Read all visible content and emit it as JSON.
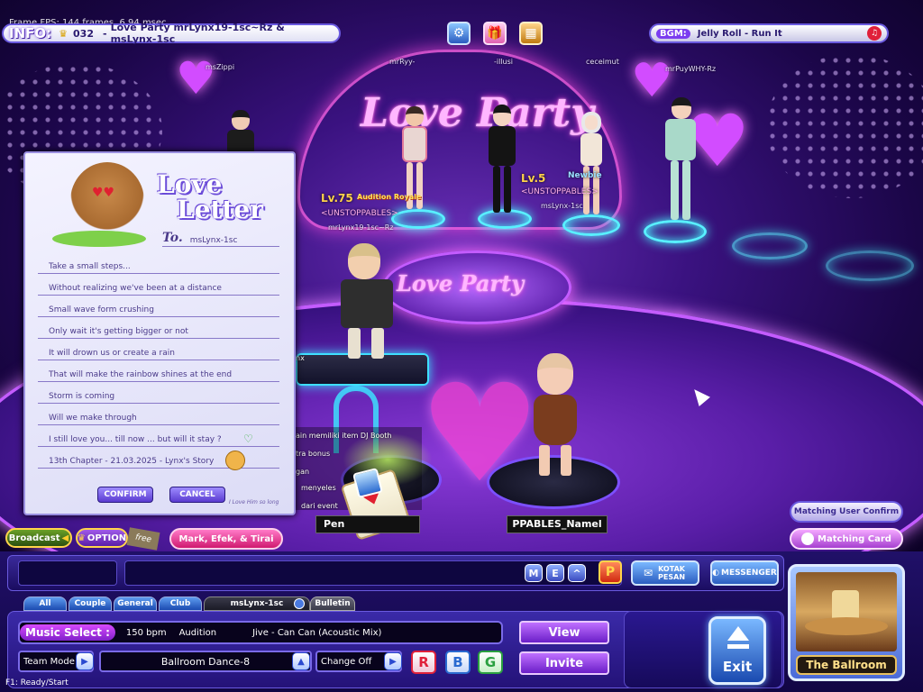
{
  "debug": {
    "text": "Frame FPS: 144 frames, 6.94 msec"
  },
  "info_bar": {
    "label": "INFO:",
    "room_number": "032",
    "room_title": "Love Party mrLynx19-1sc~Rz & msLynx-1sc"
  },
  "bgm": {
    "label": "BGM:",
    "song": "Jelly Roll - Run It"
  },
  "stage": {
    "sign_text": "Love Party",
    "floor_sign_text": "Love Party",
    "players": [
      {
        "name": "msZippi"
      },
      {
        "name": "mrRyy-"
      },
      {
        "name": "-illusi"
      },
      {
        "name": "ceceimut"
      },
      {
        "name": "mrPuyWHY-Rz"
      }
    ],
    "tags": {
      "level_a": "Lv.75",
      "title_a": "Audition Royale",
      "guild_a": "<UNSTOPPABLES>",
      "name_a": "mrLynx19-1sc~Rz",
      "level_b": "Lv.5",
      "guild_b": "<UNSTOPPABLES>",
      "newbie": "Newbie",
      "name_b": "msLynx-1sc"
    },
    "chat_fragments": [
      "nx",
      "ain memiliki item DJ Booth",
      "tra bonus",
      "gan",
      "menyeles",
      "dari event"
    ],
    "nameplate_left": "Pen",
    "nameplate_right": "PPABLES_Namel"
  },
  "letter": {
    "title_line1": "Love",
    "title_line2": "Letter",
    "to_label": "To.",
    "recipient": "msLynx-1sc",
    "lines": [
      "Take a small steps...",
      "Without realizing we've been at a distance",
      "Small wave form crushing",
      "Only wait it's getting bigger or not",
      "It will drown us or create a rain",
      "That will make the rainbow shines at the end",
      "Storm is coming",
      "Will we make through",
      "I still love you... till now ... but will it stay ?",
      "13th Chapter - 21.03.2025 - Lynx's Story"
    ],
    "confirm_label": "CONFIRM",
    "cancel_label": "CANCEL",
    "signature": "I Love Him so long"
  },
  "left_controls": {
    "broadcast_label": "Broadcast",
    "option_label": "OPTION",
    "free_tag": "free",
    "ticker": "Mark, Efek, & Tirai"
  },
  "right_controls": {
    "matching_user_label": "Matching User Confirm",
    "matching_card_label": "Matching Card"
  },
  "chat_bar": {
    "chat_value": "",
    "icons": [
      "M",
      "E",
      "^"
    ],
    "p_label": "P",
    "kotak_pesan_label": "KOTAK PESAN",
    "messenger_label": "MESSENGER"
  },
  "tabs": [
    {
      "label": "All"
    },
    {
      "label": "Couple"
    },
    {
      "label": "General"
    },
    {
      "label": "Club"
    }
  ],
  "user_tab": {
    "label": "msLynx-1sc"
  },
  "bulletin_tab": {
    "label": "Bulletin"
  },
  "music": {
    "label": "Music Select :",
    "bpm": "150 bpm",
    "mode": "Audition",
    "song": "Jive - Can Can (Acoustic Mix)"
  },
  "team": {
    "label": "Team Mode",
    "mode_value": "Ballroom Dance-8",
    "change_label": "Change Off"
  },
  "color_buttons": {
    "r": "R",
    "b": "B",
    "g": "G"
  },
  "actions": {
    "view_label": "View",
    "invite_label": "Invite",
    "exit_label": "Exit"
  },
  "room_preview": {
    "name": "The Ballroom"
  },
  "status": {
    "text": "F1: Ready/Start"
  },
  "colors": {
    "accent_purple": "#7b3cf0",
    "accent_cyan": "#58f0ff",
    "pink": "#ff5fd0",
    "status_red": "#e0203a"
  }
}
